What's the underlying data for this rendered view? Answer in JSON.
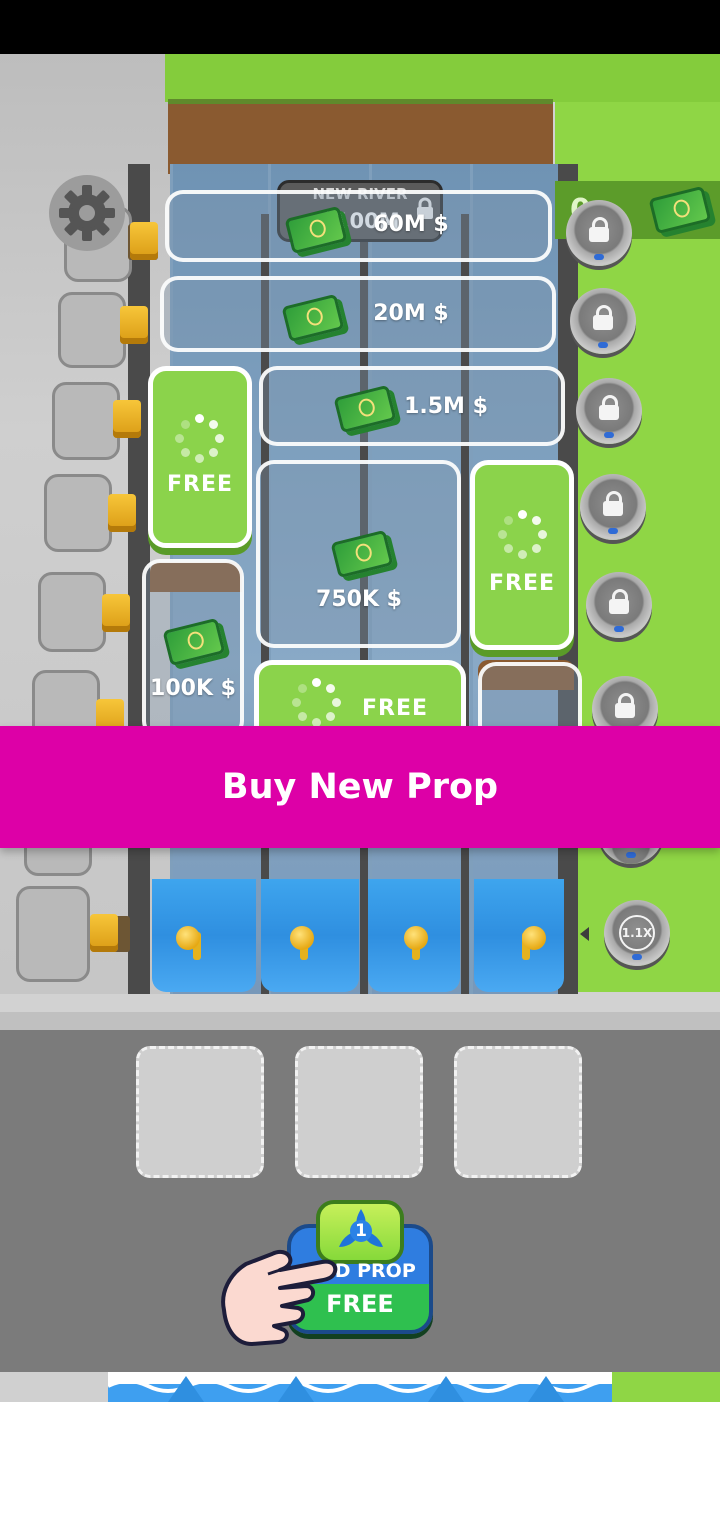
{
  "header": {
    "new_river_title": "NEW RIVER",
    "new_river_price": "$100M",
    "coin_count": "0"
  },
  "icons": {
    "settings": "gear-icon",
    "currency": "cash-stack-icon",
    "lock": "lock-icon",
    "propeller": "propeller-icon",
    "tutorial_hand": "pointing-hand-icon"
  },
  "tiers": {
    "t60m": "60M $",
    "t20m": "20M $",
    "t1_5m": "1.5M $",
    "t750k": "750K $",
    "t100k": "100K $"
  },
  "free_slots": {
    "left": "FREE",
    "right": "FREE",
    "bottom": "FREE"
  },
  "multiplier_badge": "1.1X",
  "banner": {
    "label": "Buy New Prop"
  },
  "add_prop_button": {
    "count": "1",
    "label": "ADD PROP",
    "price": "FREE"
  },
  "colors": {
    "banner": "#dd00a7",
    "grass": "#8fd645",
    "water": "#2f8fe0",
    "money": "#2f9e3a"
  }
}
